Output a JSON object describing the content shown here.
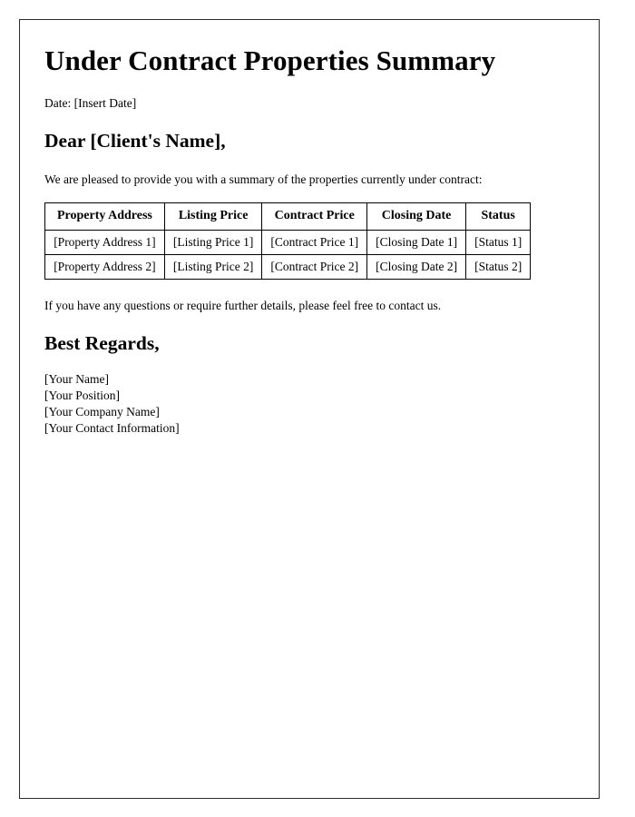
{
  "document": {
    "title": "Under Contract Properties Summary",
    "date_line": "Date: [Insert Date]",
    "salutation": "Dear [Client's Name],",
    "intro_paragraph": "We are pleased to provide you with a summary of the properties currently under contract:",
    "contact_paragraph": "If you have any questions or require further details, please feel free to contact us.",
    "signoff": "Best Regards,",
    "signature": {
      "name": "[Your Name]",
      "position": "[Your Position]",
      "company": "[Your Company Name]",
      "contact": "[Your Contact Information]"
    }
  },
  "table": {
    "headers": [
      "Property Address",
      "Listing Price",
      "Contract Price",
      "Closing Date",
      "Status"
    ],
    "rows": [
      [
        "[Property Address 1]",
        "[Listing Price 1]",
        "[Contract Price 1]",
        "[Closing Date 1]",
        "[Status 1]"
      ],
      [
        "[Property Address 2]",
        "[Listing Price 2]",
        "[Contract Price 2]",
        "[Closing Date 2]",
        "[Status 2]"
      ]
    ]
  },
  "colors": {
    "page_border": "#2b2b2b",
    "table_border": "#000000",
    "text": "#000000",
    "background": "#ffffff"
  }
}
